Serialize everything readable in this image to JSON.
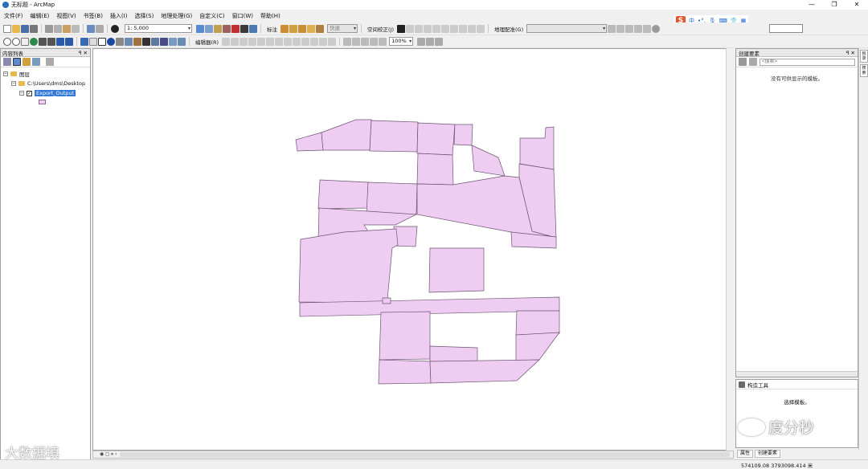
{
  "window": {
    "title": "无标题 - ArcMap",
    "controls": [
      "—",
      "❐",
      "✕"
    ]
  },
  "menu": [
    "文件(F)",
    "编辑(E)",
    "视图(V)",
    "书签(B)",
    "插入(I)",
    "选择(S)",
    "地理处理(G)",
    "自定义(C)",
    "窗口(W)",
    "帮助(H)"
  ],
  "toolbar1": {
    "scale": "1: 5,000",
    "labeling_label": "标注",
    "fast_combo": "快速",
    "spatial_adjust_label": "空间校正(J)",
    "georef_label": "地理配准(G)"
  },
  "toolbar2": {
    "editor_label": "编辑器(R)",
    "zoom_percent": "100%"
  },
  "toc": {
    "title": "内容列表",
    "pin": "ꟼ ✕",
    "dataframe": "图层",
    "folder": "C:\\Users\\dms\\Desktop",
    "layer": "Export_Output",
    "checked": "✓"
  },
  "create_features": {
    "title": "创建要素",
    "search_placeholder": "<搜索>",
    "empty_message": "没有可供显示的模板。"
  },
  "construct_tools": {
    "title": "构造工具",
    "message": "选择模板。"
  },
  "bottom_tabs": [
    "属性",
    "创建要素"
  ],
  "side_strip_tabs": [
    "目录",
    "搜索"
  ],
  "map_nav": "◉ ◻ ⏸ ‹",
  "status": {
    "coordinates": "574109.08   3793098.414 米"
  },
  "ime": {
    "logo": "S",
    "items": [
      "中",
      "•°,",
      "🎙",
      "⌨",
      "👕",
      "▦"
    ]
  },
  "watermarks": {
    "left": "大数据填",
    "right": "度分秒"
  },
  "colors": {
    "polygon_fill": "#efcdf2",
    "polygon_stroke": "#6a5470",
    "selected_layer": "#3478d8"
  }
}
